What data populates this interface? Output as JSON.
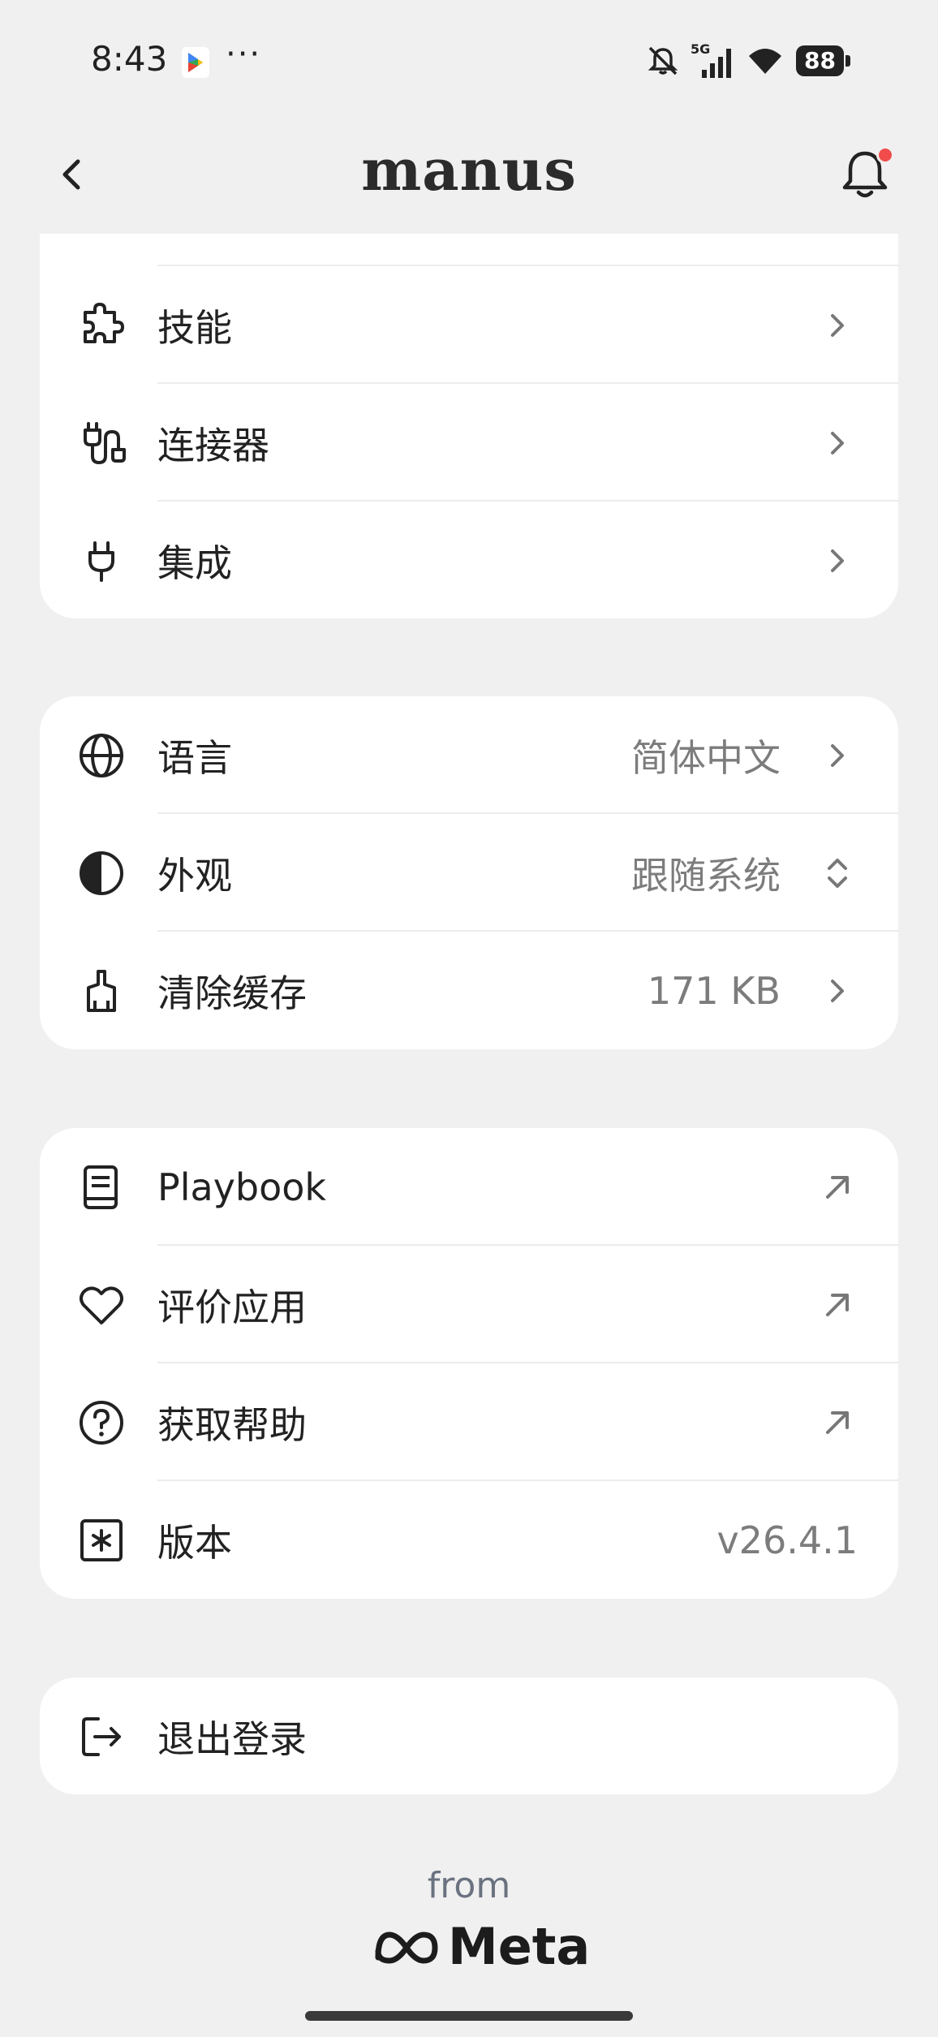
{
  "status_bar": {
    "time": "8:43",
    "dots": "···",
    "network": "5G",
    "battery": "88"
  },
  "header": {
    "logo": "manus"
  },
  "group1": {
    "items": [
      {
        "label": "技能",
        "icon": "puzzle-icon"
      },
      {
        "label": "连接器",
        "icon": "connector-icon"
      },
      {
        "label": "集成",
        "icon": "plug-icon"
      }
    ]
  },
  "group2": {
    "items": [
      {
        "label": "语言",
        "value": "简体中文",
        "icon": "globe-icon"
      },
      {
        "label": "外观",
        "value": "跟随系统",
        "icon": "contrast-icon"
      },
      {
        "label": "清除缓存",
        "value": "171 KB",
        "icon": "broom-icon"
      }
    ]
  },
  "group3": {
    "items": [
      {
        "label": "Playbook",
        "icon": "book-icon"
      },
      {
        "label": "评价应用",
        "icon": "heart-icon"
      },
      {
        "label": "获取帮助",
        "icon": "help-icon"
      },
      {
        "label": "版本",
        "value": "v26.4.1",
        "icon": "asterisk-icon"
      }
    ]
  },
  "logout": {
    "label": "退出登录",
    "icon": "logout-icon"
  },
  "footer": {
    "from": "from",
    "brand": "Meta"
  },
  "colors": {
    "background": "#f0f0f0",
    "card": "#ffffff",
    "notification_dot": "#f24b4b",
    "secondary_text": "#7c7c7c"
  }
}
